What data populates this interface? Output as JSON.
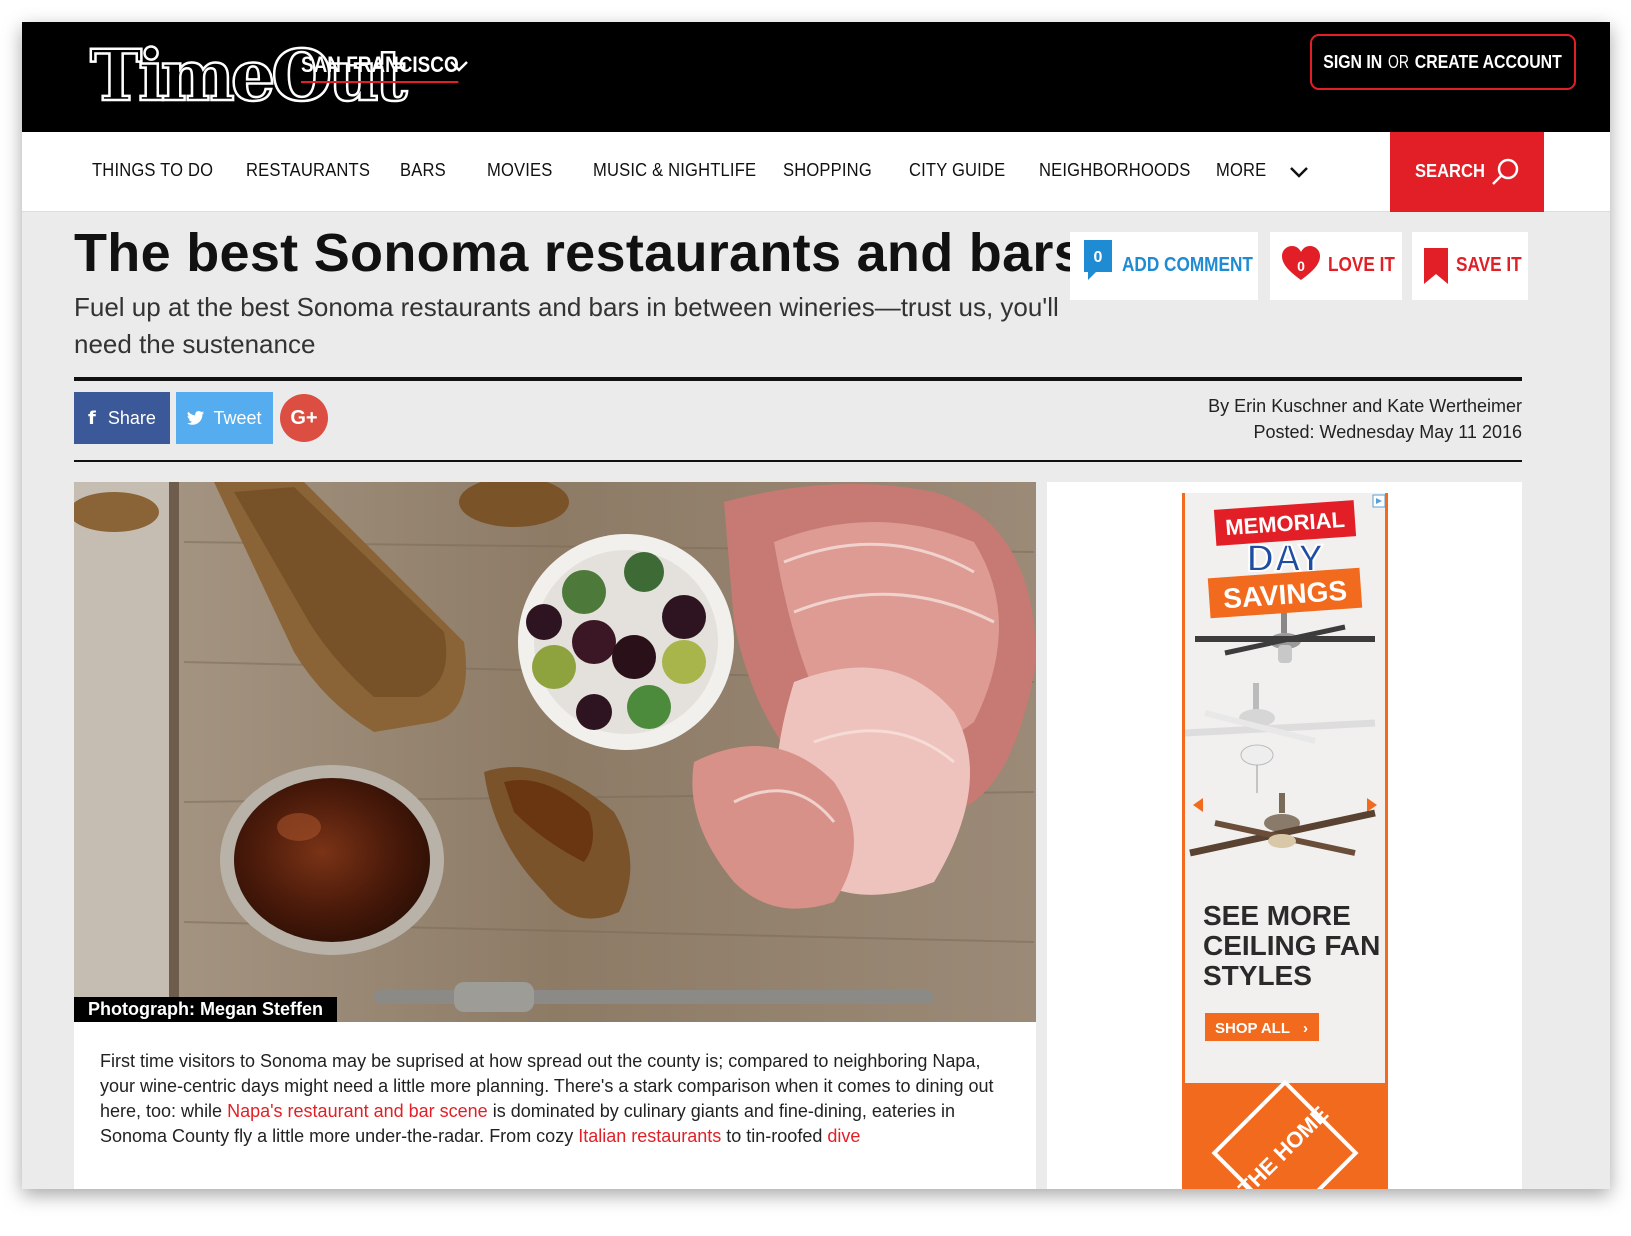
{
  "header": {
    "logo_text": "TimeOut",
    "city": "SAN FRANCISCO",
    "signin_bold1": "SIGN IN",
    "signin_or": " OR ",
    "signin_bold2": "CREATE ACCOUNT"
  },
  "nav": {
    "items": [
      "THINGS TO DO",
      "RESTAURANTS",
      "BARS",
      "MOVIES",
      "MUSIC & NIGHTLIFE",
      "SHOPPING",
      "CITY GUIDE",
      "NEIGHBORHOODS",
      "MORE"
    ],
    "search_label": "SEARCH"
  },
  "article": {
    "title": "The best Sonoma restaurants and bars",
    "subtitle": "Fuel up at the best Sonoma restaurants and bars in between wineries—trust us, you'll need the sustenance",
    "actions": {
      "comment_count": "0",
      "comment_label": "ADD COMMENT",
      "love_count": "0",
      "love_label": "LOVE IT",
      "save_label": "SAVE IT"
    },
    "share": {
      "facebook": "Share",
      "twitter": "Tweet",
      "gplus": "G+"
    },
    "byline": "By Erin Kuschner and Kate Wertheimer",
    "posted": "Posted: Wednesday May 11 2016",
    "photo_credit": "Photograph: Megan Steffen",
    "body": {
      "t1": "First time visitors to Sonoma may be suprised at how spread out the county is; compared to neighboring Napa, your wine-centric days might need a little more planning. There's a stark comparison when it comes to dining out here, too: while ",
      "link1": "Napa's restaurant and bar scene",
      "t2": " is dominated by culinary giants and fine-dining, eateries in Sonoma County fly a little more under-the-radar. From cozy ",
      "link2": "Italian restaurants",
      "t3": " to tin-roofed ",
      "link3": "dive"
    }
  },
  "ad": {
    "headline1": "MEMORIAL",
    "headline2": "DAY",
    "headline3": "SAVINGS",
    "cta1": "SEE MORE",
    "cta2": "CEILING FAN",
    "cta3": "STYLES",
    "button": "SHOP ALL",
    "brand": "THE HOME"
  },
  "colors": {
    "brand_red": "#e21f26",
    "comment_blue": "#1e8bd3",
    "facebook": "#3b5998",
    "twitter": "#55acee",
    "gplus": "#dc4e41",
    "ad_orange": "#f26a1e"
  }
}
